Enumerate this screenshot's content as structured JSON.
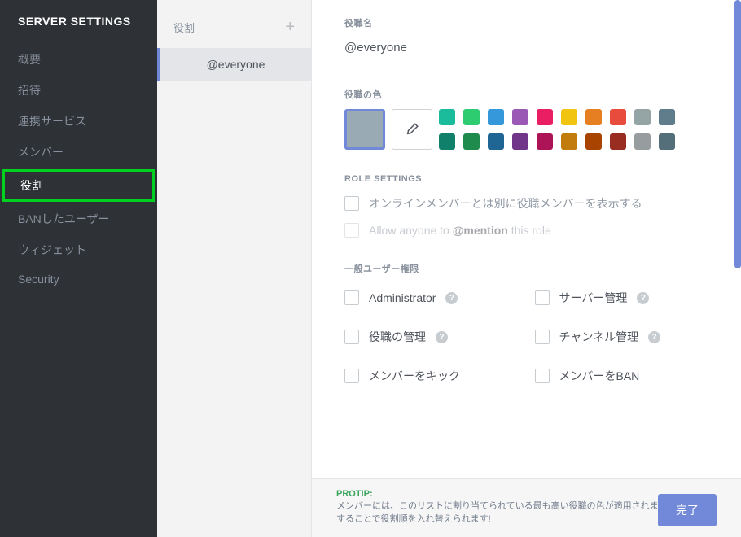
{
  "sidebar": {
    "title": "SERVER SETTINGS",
    "items": [
      {
        "label": "概要"
      },
      {
        "label": "招待"
      },
      {
        "label": "連携サービス"
      },
      {
        "label": "メンバー"
      },
      {
        "label": "役割",
        "active": true,
        "highlighted": true
      },
      {
        "label": "BANしたユーザー"
      },
      {
        "label": "ウィジェット"
      },
      {
        "label": "Security"
      }
    ]
  },
  "mid": {
    "header": "役割",
    "add": "+",
    "roles": [
      {
        "label": "@everyone",
        "active": true
      }
    ]
  },
  "main": {
    "role_name_label": "役職名",
    "role_name_value": "@everyone",
    "role_color_label": "役職の色",
    "colors_row1": [
      "#1abc9c",
      "#2ecc71",
      "#3498db",
      "#9b59b6",
      "#e91e63",
      "#f1c40f",
      "#e67e22",
      "#e74c3c",
      "#95a5a6",
      "#607d8b"
    ],
    "colors_row2": [
      "#11806a",
      "#1f8b4c",
      "#206694",
      "#71368a",
      "#ad1457",
      "#c27c0e",
      "#a84300",
      "#992d22",
      "#979c9f",
      "#546e7a"
    ],
    "role_settings_label": "ROLE SETTINGS",
    "toggle1": "オンラインメンバーとは別に役職メンバーを表示する",
    "toggle2_prefix": "Allow anyone to ",
    "toggle2_mention": "@mention",
    "toggle2_suffix": " this role",
    "perm_label": "一般ユーザー権限",
    "perms": [
      {
        "label": "Administrator",
        "help": true
      },
      {
        "label": "サーバー管理",
        "help": true
      },
      {
        "label": "役職の管理",
        "help": true
      },
      {
        "label": "チャンネル管理",
        "help": true
      },
      {
        "label": "メンバーをキック",
        "help": false
      },
      {
        "label": "メンバーをBAN",
        "help": false
      }
    ]
  },
  "footer": {
    "protip": "PROTIP:",
    "text": "メンバーには、このリストに割り当てられている最も高い役職の色が適用されます。ドラッグすることで役割順を入れ替えられます!",
    "done": "完了"
  }
}
